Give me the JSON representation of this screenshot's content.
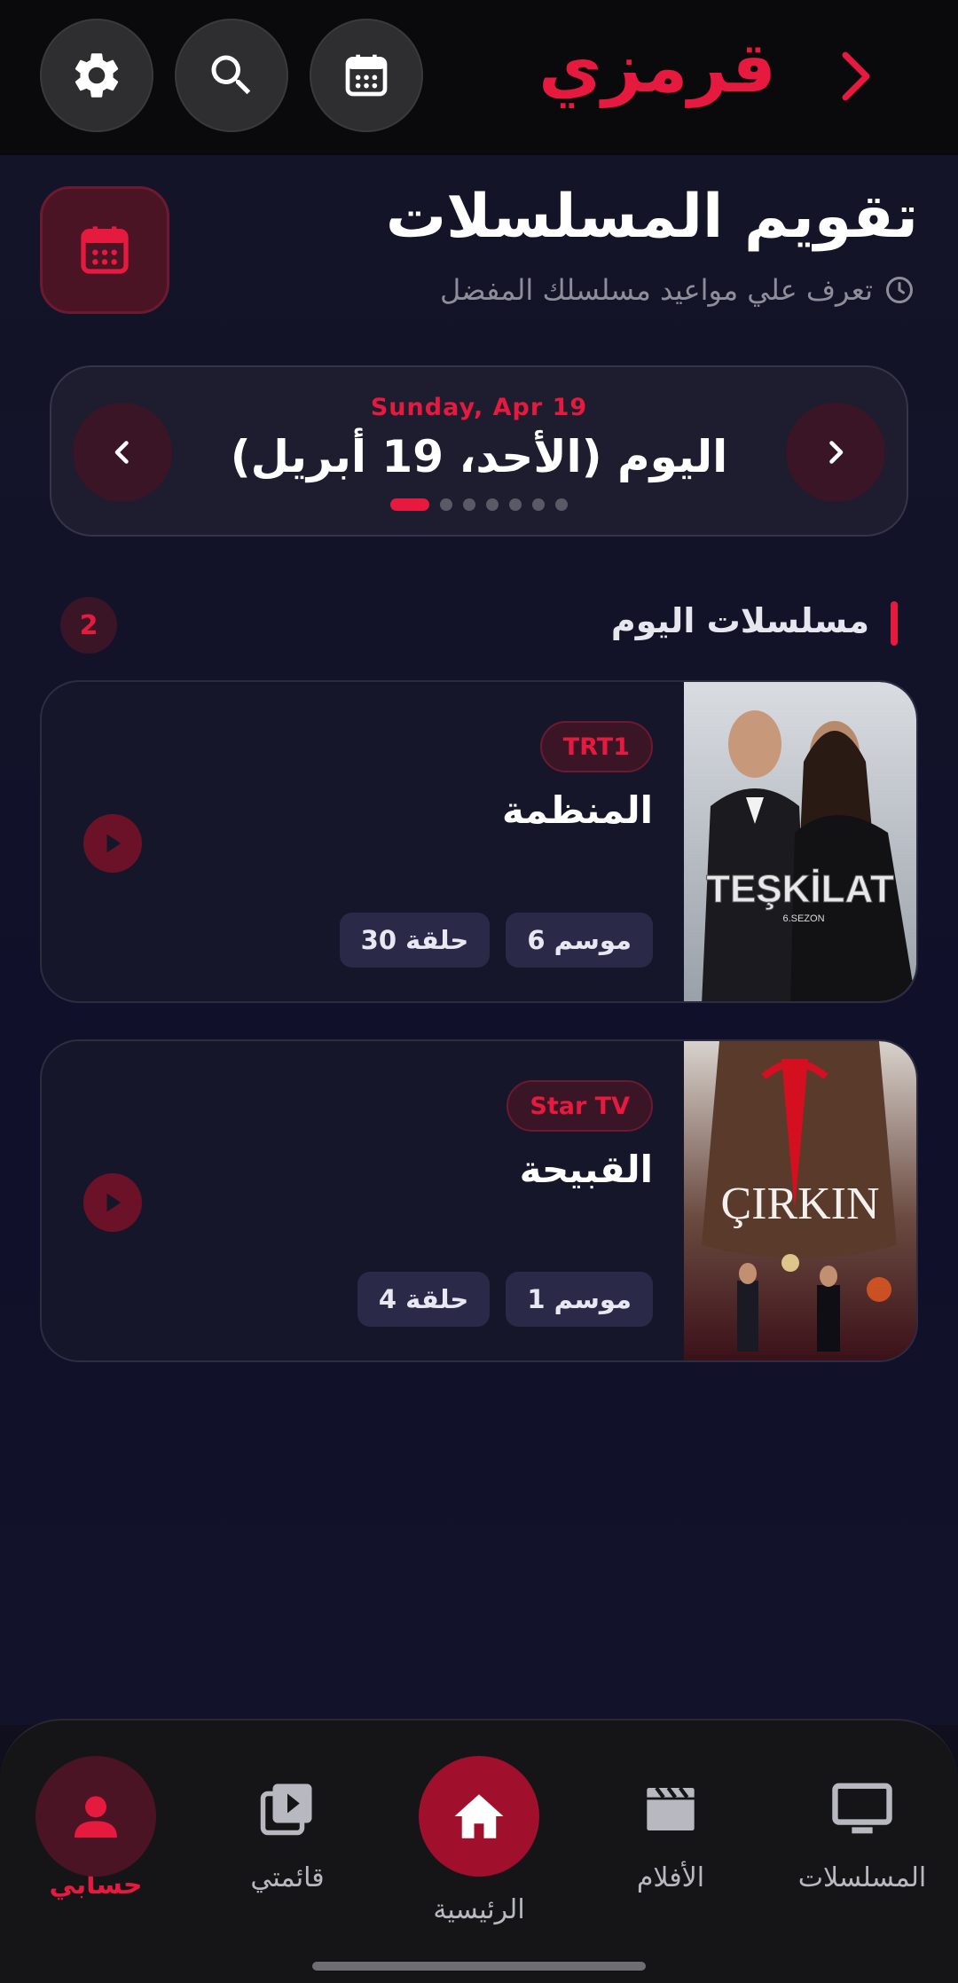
{
  "header": {
    "brand": "قرمزي",
    "icons": [
      "back-chevron-icon",
      "calendar-icon",
      "search-icon",
      "gear-icon"
    ]
  },
  "page": {
    "title": "تقويم المسلسلات",
    "subtitle": "تعرف علي مواعيد مسلسلك المفضل"
  },
  "date_selector": {
    "date_en": "Sunday, Apr 19",
    "date_ar": "اليوم (الأحد، 19 أبريل)",
    "dots_count": 7,
    "active_dot": 0
  },
  "section": {
    "title": "مسلسلات اليوم",
    "count": "2"
  },
  "shows": [
    {
      "channel": "TRT1",
      "name": "المنظمة",
      "season": "موسم 6",
      "episode": "حلقة 30",
      "poster_title": "TEŞKİLAT",
      "poster_subtitle": "6.SEZON"
    },
    {
      "channel": "Star TV",
      "name": "القبيحة",
      "season": "موسم 1",
      "episode": "حلقة 4",
      "poster_title": "ÇIRKIN"
    }
  ],
  "bottom_nav": [
    {
      "label": "حسابي",
      "active": true
    },
    {
      "label": "قائمتي",
      "active": false
    },
    {
      "label": "الرئيسية",
      "active": false
    },
    {
      "label": "الأفلام",
      "active": false
    },
    {
      "label": "المسلسلات",
      "active": false
    }
  ],
  "colors": {
    "accent": "#e6193f",
    "background": "#12122a",
    "card": "#16162a"
  }
}
